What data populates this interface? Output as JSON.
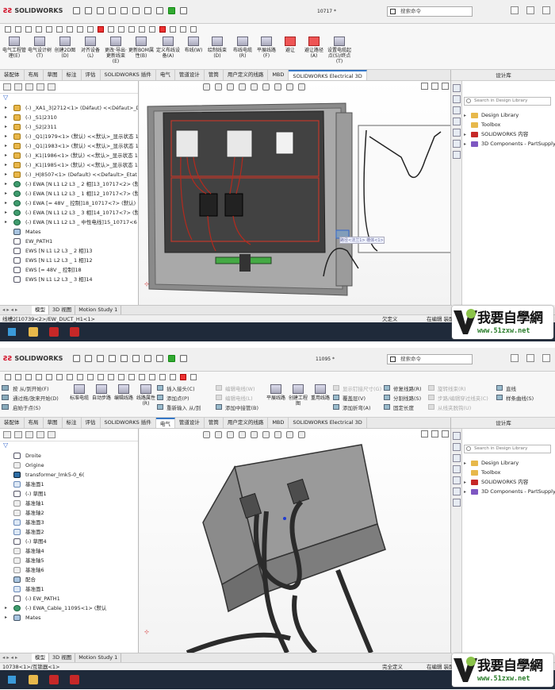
{
  "shots": [
    {
      "app_name": "SOLIDWORKS",
      "filename": "10717 *",
      "search_placeholder": "搜索命令",
      "ribbon_buttons": [
        "电气工程管理(E)",
        "电气设计树(T)",
        "创建2D图(D)",
        "对齐设备(L)",
        "更改·导出·更新线束(E)",
        "更新BOM属性(B)",
        "定义布线设备(A)",
        "布线(W)",
        "绘制线束(D)",
        "布线电缆(R)",
        "平展线路(F)",
        "避让",
        "避让路径(A)",
        "设置电缆起点(S)/终点(T)"
      ],
      "tabs": [
        "装配体",
        "布局",
        "草图",
        "标注",
        "评估",
        "SOLIDWORKS 插件",
        "电气",
        "管道设计",
        "管筒",
        "用户定义的线路",
        "MBD",
        "SOLIDWORKS Electrical 3D"
      ],
      "active_tab": "SOLIDWORKS Electrical 3D",
      "tree_items": [
        {
          "label": "(-) _XA1_3|2712<1> (Défaut) <<Défaut>_Dét",
          "icon": "cmp",
          "arrow": "▸"
        },
        {
          "label": "(-) _S1|2310",
          "icon": "cmp",
          "arrow": "▸"
        },
        {
          "label": "(-) _S2|2311",
          "icon": "cmp",
          "arrow": "▸"
        },
        {
          "label": "(-) _Q1|1979<1> (默认) <<默认>_显示状态 1",
          "icon": "cmp",
          "arrow": "▸"
        },
        {
          "label": "(-) _Q1|1983<1> (默认) <<默认>_显示状态 1",
          "icon": "cmp",
          "arrow": "▸"
        },
        {
          "label": "(-) _K1|1986<1> (默认) <<默认>_显示状态 1",
          "icon": "cmp",
          "arrow": "▸"
        },
        {
          "label": "(-) _K1|1985<1> (默认) <<默认>_显示状态 1",
          "icon": "cmp",
          "arrow": "▸"
        },
        {
          "label": "(-) _H|8507<1> (Default) <<Default>_Etat",
          "icon": "cmp",
          "arrow": "▸"
        },
        {
          "label": "(-) EWA [N L1 L2 L3 _ 2 相]13_10717<2> (默",
          "icon": "wire",
          "arrow": "▸"
        },
        {
          "label": "(-) EWA [N L1 L2 L3 _ 1 相]12_10717<7> (默",
          "icon": "wire",
          "arrow": "▸"
        },
        {
          "label": "(-) EWA [= 48V _ 控制]18_10717<7> (默认)",
          "icon": "wire",
          "arrow": "▸"
        },
        {
          "label": "(-) EWA [N L1 L2 L3 _ 3 相]14_10717<7> (默",
          "icon": "wire",
          "arrow": "▸"
        },
        {
          "label": "(-) EWA [N L1 L2 L3 _ 中性电线]15_10717<6",
          "icon": "wire",
          "arrow": "▸"
        },
        {
          "label": "Mates",
          "icon": "mt",
          "arrow": ""
        },
        {
          "label": "EW_PATH1",
          "icon": "sk",
          "arrow": ""
        },
        {
          "label": "EWS [N L1 L2 L3 _ 2 相]13",
          "icon": "sk",
          "arrow": ""
        },
        {
          "label": "EWS [N L1 L2 L3 _ 1 相]12",
          "icon": "sk",
          "arrow": ""
        },
        {
          "label": "EWS [= 48V _ 控制]18",
          "icon": "sk",
          "arrow": ""
        },
        {
          "label": "EWS [N L1 L2 L3 _ 3 相]14",
          "icon": "sk",
          "arrow": ""
        }
      ],
      "design_library_title": "设计库",
      "design_search": "Search in Design Library",
      "library_items": [
        "Design Library",
        "Toolbox",
        "SOLIDWORKS 内容",
        "3D Components - PartSupply"
      ],
      "bottom_tabs": [
        "模型",
        "3D 视图",
        "Motion Study 1"
      ],
      "status_left": "线槽2[10739<2>/EW_DUCT_H1<1>",
      "status_mid": "欠定义",
      "status_right": "在编辑 装配体",
      "viewport_tooltip": "路径<法兰1> 槽体<1>"
    },
    {
      "app_name": "SOLIDWORKS",
      "filename": "11095 *",
      "search_placeholder": "搜索命令",
      "ribbon_left": [
        "按 从/到开始(F)",
        "通过拖/放来开始(D)",
        "启始于点(S)"
      ],
      "ribbon_buttons": [
        "标准电缆",
        "自动步路",
        "编辑线路",
        "线路属性(R)"
      ],
      "ribbon_mid_a": [
        "插入接头(C)",
        "添加点(P)",
        "重新输入 从/到"
      ],
      "ribbon_mid_b": [
        "编辑电线(W)",
        "编辑电线(L)",
        "添加中接管(B)"
      ],
      "ribbon_buttons2": [
        "平展线路",
        "创建工程图",
        "重用线路"
      ],
      "ribbon_mid_c": [
        "显示钉接尺寸(G)",
        "覆盖层(V)",
        "添加折弯(A)"
      ],
      "ribbon_mid_d": [
        "修复线路(R)",
        "分割线路(S)",
        "固定长度"
      ],
      "ribbon_mid_e": [
        "旋转线束(R)",
        "步路/编辑穿过线夹(C)",
        "从线夹脱钩(U)"
      ],
      "ribbon_right": [
        "直线",
        "样条曲线(S)"
      ],
      "tabs": [
        "装配体",
        "布局",
        "草图",
        "标注",
        "评估",
        "SOLIDWORKS 插件",
        "电气",
        "管道设计",
        "管筒",
        "用户定义的线路",
        "MBD",
        "SOLIDWORKS Electrical 3D"
      ],
      "active_tab": "电气",
      "tree_items": [
        {
          "label": "Droite",
          "icon": "sk",
          "arrow": ""
        },
        {
          "label": "Origine",
          "icon": "fd",
          "arrow": ""
        },
        {
          "label": "transformer_lmk5-0_6(",
          "icon": "pt",
          "arrow": ""
        },
        {
          "label": "基准面1",
          "icon": "pl",
          "arrow": ""
        },
        {
          "label": "(-) 草图1",
          "icon": "sk",
          "arrow": ""
        },
        {
          "label": "基准轴1",
          "icon": "fd",
          "arrow": ""
        },
        {
          "label": "基准轴2",
          "icon": "fd",
          "arrow": ""
        },
        {
          "label": "基准面3",
          "icon": "pl",
          "arrow": ""
        },
        {
          "label": "基准面2",
          "icon": "pl",
          "arrow": ""
        },
        {
          "label": "(-) 草图4",
          "icon": "sk",
          "arrow": ""
        },
        {
          "label": "基准轴4",
          "icon": "fd",
          "arrow": ""
        },
        {
          "label": "基准轴5",
          "icon": "fd",
          "arrow": ""
        },
        {
          "label": "基准轴6",
          "icon": "fd",
          "arrow": ""
        },
        {
          "label": "配合",
          "icon": "mt",
          "arrow": ""
        },
        {
          "label": "基准面1",
          "icon": "pl",
          "arrow": ""
        },
        {
          "label": "(-) EW_PATH1",
          "icon": "sk",
          "arrow": ""
        },
        {
          "label": "(-) EWA_Cable_11095<1> (默认",
          "icon": "wire",
          "arrow": "▸"
        },
        {
          "label": "Mates",
          "icon": "mt",
          "arrow": "▸"
        }
      ],
      "design_library_title": "设计库",
      "design_search": "Search in Design Library",
      "library_items": [
        "Design Library",
        "Toolbox",
        "SOLIDWORKS 内容",
        "3D Components - PartSupply"
      ],
      "bottom_tabs": [
        "模型",
        "3D 视图",
        "Motion Study 1"
      ],
      "status_left": "10738<1>/互锁器<1>",
      "status_mid": "完全定义",
      "status_right": "在编辑 装配体"
    }
  ],
  "watermark": {
    "title": "我要自學網",
    "url": "www.51zxw.net"
  },
  "colors": {
    "accent": "#3778c7",
    "brand_red": "#d0021b",
    "wire_red": "#b52a1e",
    "cable_dark": "#2b2b2b"
  }
}
